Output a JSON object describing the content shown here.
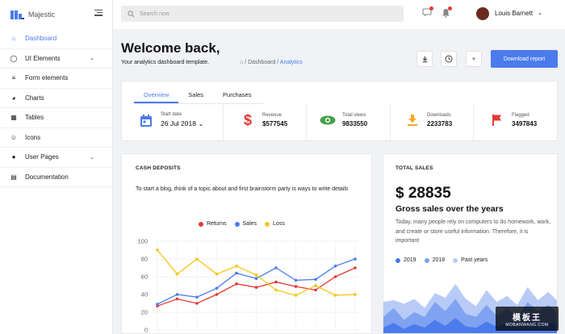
{
  "app": {
    "name": "Majestic"
  },
  "sidebar": {
    "items": [
      {
        "label": "Dashboard",
        "icon": "home-icon",
        "glyph": "⌂",
        "active": true,
        "expandable": false
      },
      {
        "label": "UI Elements",
        "icon": "circle-icon",
        "glyph": "◯",
        "active": false,
        "expandable": true
      },
      {
        "label": "Form elements",
        "icon": "list-icon",
        "glyph": "≡",
        "active": false,
        "expandable": false
      },
      {
        "label": "Charts",
        "icon": "pie-chart-icon",
        "glyph": "◕",
        "active": false,
        "expandable": false
      },
      {
        "label": "Tables",
        "icon": "grid-icon",
        "glyph": "▦",
        "active": false,
        "expandable": false
      },
      {
        "label": "Icons",
        "icon": "smiley-icon",
        "glyph": "☺",
        "active": false,
        "expandable": false
      },
      {
        "label": "User Pages",
        "icon": "user-icon",
        "glyph": "●",
        "active": false,
        "expandable": true
      },
      {
        "label": "Documentation",
        "icon": "document-icon",
        "glyph": "▤",
        "active": false,
        "expandable": false
      }
    ]
  },
  "topbar": {
    "search_placeholder": "Search now",
    "user_name": "Louis Barnett"
  },
  "header": {
    "title": "Welcome back,",
    "subtitle": "Your analytics dashboard template.",
    "breadcrumb": {
      "home": "⌂",
      "sep": " / ",
      "parent": "Dashboard",
      "current": "Analytics"
    },
    "download_label": "Download report"
  },
  "stats": {
    "tabs": [
      "Overview",
      "Sales",
      "Purchases"
    ],
    "active_tab": 0,
    "start_date_label": "Start date",
    "start_date_value": "26 Jul 2018",
    "items": [
      {
        "label": "Revenue",
        "value": "$577545",
        "icon": "dollar-icon",
        "color": "#e53935"
      },
      {
        "label": "Total views",
        "value": "9833550",
        "icon": "eye-icon",
        "color": "#43a047"
      },
      {
        "label": "Downloads",
        "value": "2233783",
        "icon": "download-icon",
        "color": "#f9a825"
      },
      {
        "label": "Flagged",
        "value": "3497843",
        "icon": "flag-icon",
        "color": "#e53935"
      }
    ]
  },
  "cash_deposits": {
    "title": "CASH DEPOSITS",
    "description": "To start a blog, think of a topic about and first brainstorm party is ways to write details"
  },
  "total_sales": {
    "title": "TOTAL SALES",
    "amount": "$ 28835",
    "heading": "Gross sales over the years",
    "description": "Today, many people rely on computers to do homework, work, and create or store useful information. Therefore, it is important",
    "legend": [
      {
        "label": "2019",
        "color": "#4b7bec"
      },
      {
        "label": "2018",
        "color": "#7fa3f0"
      },
      {
        "label": "Past years",
        "color": "#b8cbf7"
      }
    ]
  },
  "watermark": {
    "main": "模板王",
    "sub": "MOBANWANG.COM"
  },
  "chart_data": [
    {
      "type": "line",
      "title": "",
      "x": [
        1,
        2,
        3,
        4,
        5,
        6,
        7,
        8,
        9,
        10,
        11
      ],
      "ylim": [
        0,
        100
      ],
      "yticks": [
        0,
        20,
        40,
        60,
        80,
        100
      ],
      "grid": true,
      "legend_position": "top",
      "series": [
        {
          "name": "Returns",
          "color": "#e53935",
          "values": [
            27,
            35,
            30,
            40,
            52,
            48,
            54,
            49,
            45,
            60,
            70
          ]
        },
        {
          "name": "Sales",
          "color": "#4b7bec",
          "values": [
            29,
            40,
            37,
            47,
            64,
            58,
            70,
            56,
            57,
            72,
            80
          ]
        },
        {
          "name": "Loss",
          "color": "#f5c518",
          "values": [
            90,
            63,
            80,
            63,
            72,
            62,
            45,
            39,
            50,
            39,
            40
          ]
        }
      ]
    },
    {
      "type": "area",
      "title": "",
      "ylim": [
        0,
        100
      ],
      "series": [
        {
          "name": "Past years",
          "color": "#b8cbf7",
          "values": [
            55,
            58,
            52,
            60,
            45,
            70,
            62,
            85,
            60,
            48,
            75,
            55,
            65,
            50,
            80,
            58,
            72,
            55
          ]
        },
        {
          "name": "2018",
          "color": "#7fa3f0",
          "values": [
            30,
            45,
            25,
            38,
            30,
            55,
            40,
            60,
            35,
            30,
            50,
            32,
            45,
            30,
            55,
            40,
            50,
            35
          ]
        },
        {
          "name": "2019",
          "color": "#4b7bec",
          "values": [
            12,
            20,
            10,
            18,
            12,
            25,
            15,
            28,
            14,
            12,
            22,
            14,
            20,
            12,
            24,
            16,
            22,
            14
          ]
        }
      ]
    }
  ]
}
